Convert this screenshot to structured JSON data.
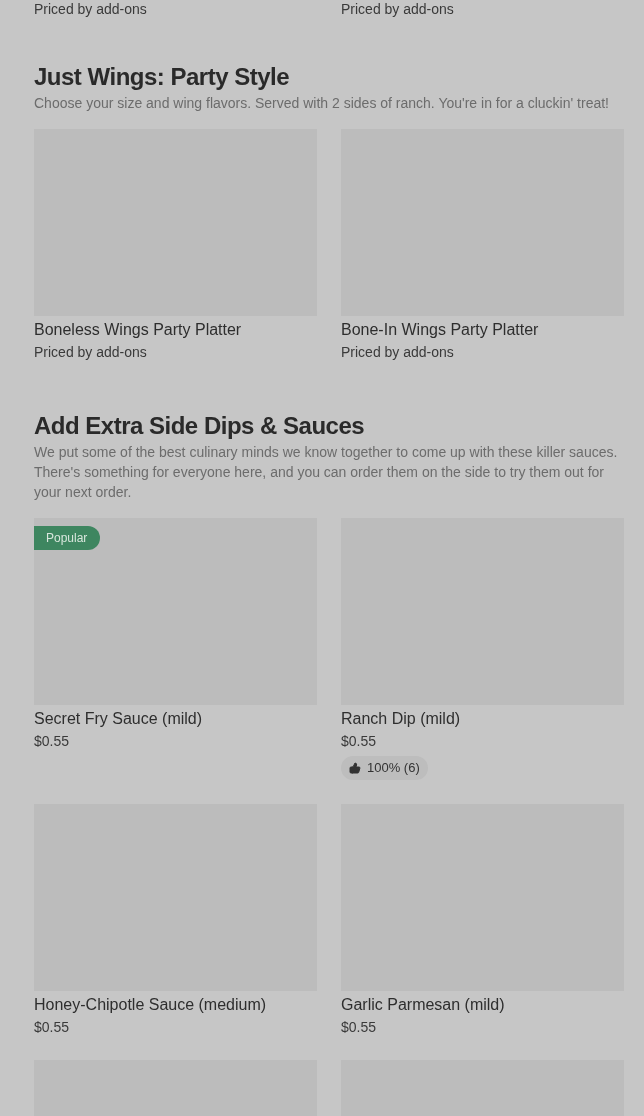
{
  "sections": [
    {
      "items": [
        {
          "kind": "price-only",
          "price": "Priced by add-ons"
        },
        {
          "kind": "price-only",
          "price": "Priced by add-ons"
        }
      ]
    },
    {
      "title": "Just Wings: Party Style",
      "description": "Choose your size and wing flavors. Served with 2 sides of ranch. You're in for a cluckin' treat!",
      "items": [
        {
          "kind": "item",
          "name": "Boneless Wings Party Platter",
          "price": "Priced by add-ons"
        },
        {
          "kind": "item",
          "name": "Bone-In Wings Party Platter",
          "price": "Priced by add-ons"
        }
      ]
    },
    {
      "title": "Add Extra Side Dips & Sauces",
      "description": "We put some of the best culinary minds we know together to come up with these killer sauces. There's something for everyone here, and you can order them on the side to try them out for your next order.",
      "items": [
        {
          "kind": "item",
          "name": "Secret Fry Sauce (mild)",
          "price": "$0.55",
          "badge": "Popular"
        },
        {
          "kind": "item",
          "name": "Ranch Dip (mild)",
          "price": "$0.55",
          "rating": "100% (6)"
        },
        {
          "kind": "item",
          "name": "Honey-Chipotle Sauce (medium)",
          "price": "$0.55"
        },
        {
          "kind": "item",
          "name": "Garlic Parmesan (mild)",
          "price": "$0.55"
        },
        {
          "kind": "cut"
        },
        {
          "kind": "cut"
        }
      ]
    }
  ]
}
